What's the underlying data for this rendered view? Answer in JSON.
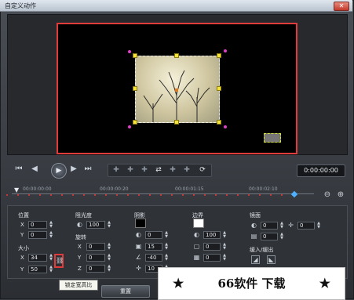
{
  "window": {
    "title": "自定义动作",
    "close_glyph": "✕"
  },
  "transport": {
    "buttons": {
      "home": "⏮",
      "prev": "◀",
      "play": "▶",
      "next": "▶",
      "end": "⏭"
    },
    "toolbar_glyphs": [
      "✚",
      "✚",
      "✚",
      "⇄",
      "✚",
      "✚",
      "⟳"
    ],
    "timecode": "0:00:00:00"
  },
  "ruler": {
    "ticks": [
      "00:00:00:00",
      "00:00:00:20",
      "00:00:01:15",
      "00:00:02:10"
    ],
    "playhead": "▼",
    "zoom_out": "⊖",
    "zoom_in": "⊕"
  },
  "panel": {
    "position": {
      "label": "位置",
      "x_label": "X",
      "x_value": "0",
      "y_label": "Y",
      "y_value": "0"
    },
    "size": {
      "label": "大小",
      "x_label": "X",
      "x_value": "34",
      "y_label": "Y",
      "y_value": "50"
    },
    "opacity": {
      "label": "阻光度",
      "value": "100"
    },
    "rotation": {
      "label": "旋转",
      "x_label": "X",
      "x_value": "0",
      "y_label": "Y",
      "y_value": "0",
      "z_label": "Z",
      "z_value": "0"
    },
    "shadow": {
      "label": "阴影",
      "color": "#000000",
      "v1": "0",
      "v2": "15",
      "v3": "-40",
      "v4": "10"
    },
    "border": {
      "label": "边界",
      "color": "#ffffff",
      "v1": "100",
      "v2": "0",
      "v3": "0"
    },
    "mirror": {
      "label": "镜面",
      "v1": "0",
      "v2": "0",
      "v3": "0",
      "v4": "0"
    },
    "fade": {
      "label": "缓入/缓出"
    }
  },
  "lock_tooltip": "锁定宽高比",
  "reset_label": "重置",
  "watermark": {
    "text": "66软件 下载",
    "star": "★"
  },
  "colors": {
    "accent_red": "#e23b3b",
    "handle_yellow": "#f5e23b",
    "corner_magenta": "#e040c8"
  }
}
